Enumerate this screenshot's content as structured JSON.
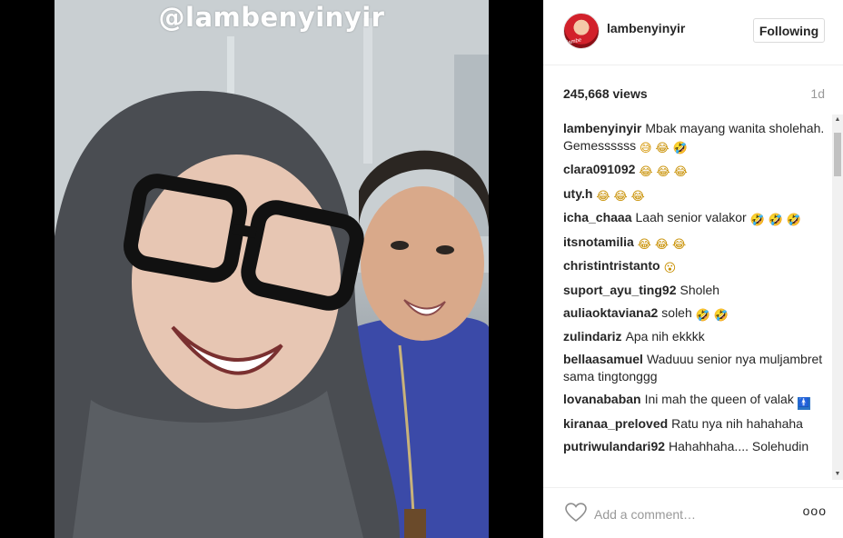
{
  "post": {
    "watermark": "@lambenyinyir",
    "author": "lambenyinyir",
    "follow_label": "Following",
    "views": "245,668 views",
    "time_ago": "1d"
  },
  "comments": [
    {
      "user": "lambenyinyir",
      "text": "Mbak mayang wanita sholehah. Gemessssss",
      "emojis": [
        "sweat-smile",
        "joy",
        "rofl"
      ]
    },
    {
      "user": "clara091092",
      "text": "",
      "emojis": [
        "joy",
        "joy",
        "joy"
      ]
    },
    {
      "user": "uty.h",
      "text": "",
      "emojis": [
        "joy",
        "joy",
        "joy"
      ]
    },
    {
      "user": "icha_chaaa",
      "text": "Laah senior valakor",
      "emojis": [
        "rofl",
        "rofl",
        "rofl"
      ]
    },
    {
      "user": "itsnotamilia",
      "text": "",
      "emojis": [
        "joy",
        "joy",
        "joy"
      ]
    },
    {
      "user": "christintristanto",
      "text": "",
      "emojis": [
        "open-mouth"
      ]
    },
    {
      "user": "suport_ayu_ting92",
      "text": "Sholeh",
      "emojis": []
    },
    {
      "user": "auliaoktaviana2",
      "text": "soleh",
      "emojis": [
        "rofl",
        "rofl"
      ]
    },
    {
      "user": "zulindariz",
      "text": "Apa nih ekkkk",
      "emojis": []
    },
    {
      "user": "bellaasamuel",
      "text": "Waduuu senior nya muljambret sama tingtonggg",
      "emojis": []
    },
    {
      "user": "lovanababan",
      "text": "Ini mah the queen of valak",
      "emojis": [
        "person-icon"
      ]
    },
    {
      "user": "kiranaa_preloved",
      "text": "Ratu nya nih hahahaha",
      "emojis": []
    },
    {
      "user": "putriwulandari92",
      "text": "Hahahhaha.... Solehudin",
      "emojis": []
    }
  ],
  "footer": {
    "comment_placeholder": "Add a comment…",
    "more_label": "ooo",
    "like_icon": "heart-icon",
    "more_icon": "more-options-icon"
  },
  "colors": {
    "text": "#262626",
    "muted": "#999999",
    "border": "#dbdbdb",
    "media_bg": "#000000"
  }
}
